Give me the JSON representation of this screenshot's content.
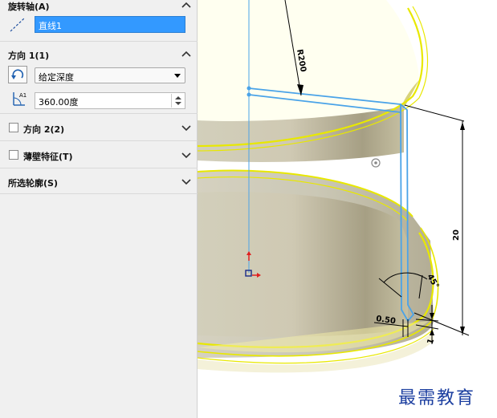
{
  "panel": {
    "axis": {
      "title": "旋转轴(A)",
      "value": "直线1"
    },
    "direction1": {
      "title": "方向 1(1)",
      "type": "给定深度",
      "angle": "360.00度"
    },
    "direction2": {
      "title": "方向 2(2)"
    },
    "thin": {
      "title": "薄壁特征(T)"
    },
    "contours": {
      "title": "所选轮廓(S)"
    }
  },
  "dimensions": {
    "radius": "R200",
    "height": "20",
    "thickness": "0.50",
    "angle": "45°",
    "small": "1"
  },
  "watermark": "最需教育",
  "colors": {
    "sketch": "#4aa3e8",
    "edge": "#e8e800",
    "body": "#c8c3a6",
    "selection": "#3399ff"
  }
}
